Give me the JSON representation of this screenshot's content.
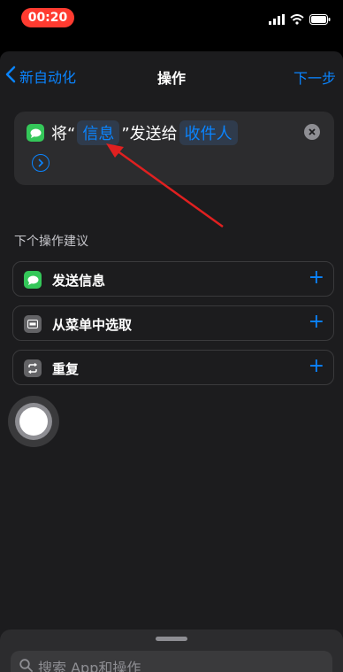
{
  "status_bar": {
    "time": "00:20",
    "icons": [
      "signal-icon",
      "wifi-icon",
      "battery-icon"
    ]
  },
  "nav": {
    "back_label": "新自动化",
    "title": "操作",
    "next_label": "下一步"
  },
  "action_card": {
    "app_icon": "messages-icon",
    "prefix": "将“",
    "message_token": "信息",
    "middle": "”发送给",
    "recipient_token": "收件人",
    "expand_icon": "chevron-right-circle-icon",
    "remove_icon": "close-circle-icon"
  },
  "suggestions": {
    "header": "下个操作建议",
    "items": [
      {
        "label": "发送信息",
        "icon": "messages-icon",
        "add": "+"
      },
      {
        "label": "从菜单中选取",
        "icon": "menu-icon",
        "add": "+"
      },
      {
        "label": "重复",
        "icon": "repeat-icon",
        "add": "+"
      }
    ]
  },
  "search": {
    "placeholder": "搜索 App和操作"
  },
  "colors": {
    "accent": "#0a84ff",
    "messages_green": "#34c759",
    "record_red": "#ff3b30",
    "annotation_red": "#e02020"
  }
}
